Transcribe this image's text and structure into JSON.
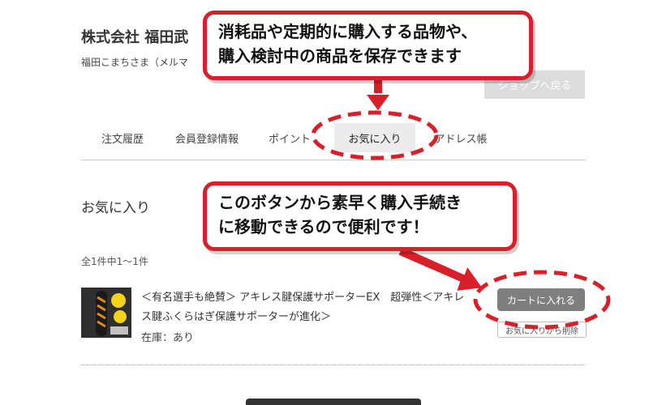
{
  "header": {
    "company_name": "株式会社 福田武",
    "greeting": "福田こまちさま（メルマ",
    "back_to_shop": "ショップへ戻る"
  },
  "tabs": [
    {
      "label": "注文履歴"
    },
    {
      "label": "会員登録情報"
    },
    {
      "label": "ポイント"
    },
    {
      "label": "お気に入り",
      "active": true
    },
    {
      "label": "アドレス帳"
    }
  ],
  "favorites": {
    "title": "お気に入り",
    "count_text": "全1件中1〜1件",
    "items": [
      {
        "title": "＜有名選手も絶賛＞ アキレス腱保護サポーターEX　超弾性＜アキレス腱ふくらはぎ保護サポーターが進化＞",
        "stock": "在庫：あり",
        "cart_button": "カートに入れる",
        "remove_button": "お気に入りから削除"
      }
    ]
  },
  "annotations": {
    "callout1": [
      "消耗品や定期的に購入する品物や、",
      "購入検討中の商品を保存できます"
    ],
    "callout2": [
      "このボタンから素早く購入手続き",
      "に移動できるので便利です！"
    ]
  },
  "colors": {
    "callout_border": "#d8202a",
    "cart_button": "#7f7f7f",
    "active_tab": "#ececec"
  }
}
